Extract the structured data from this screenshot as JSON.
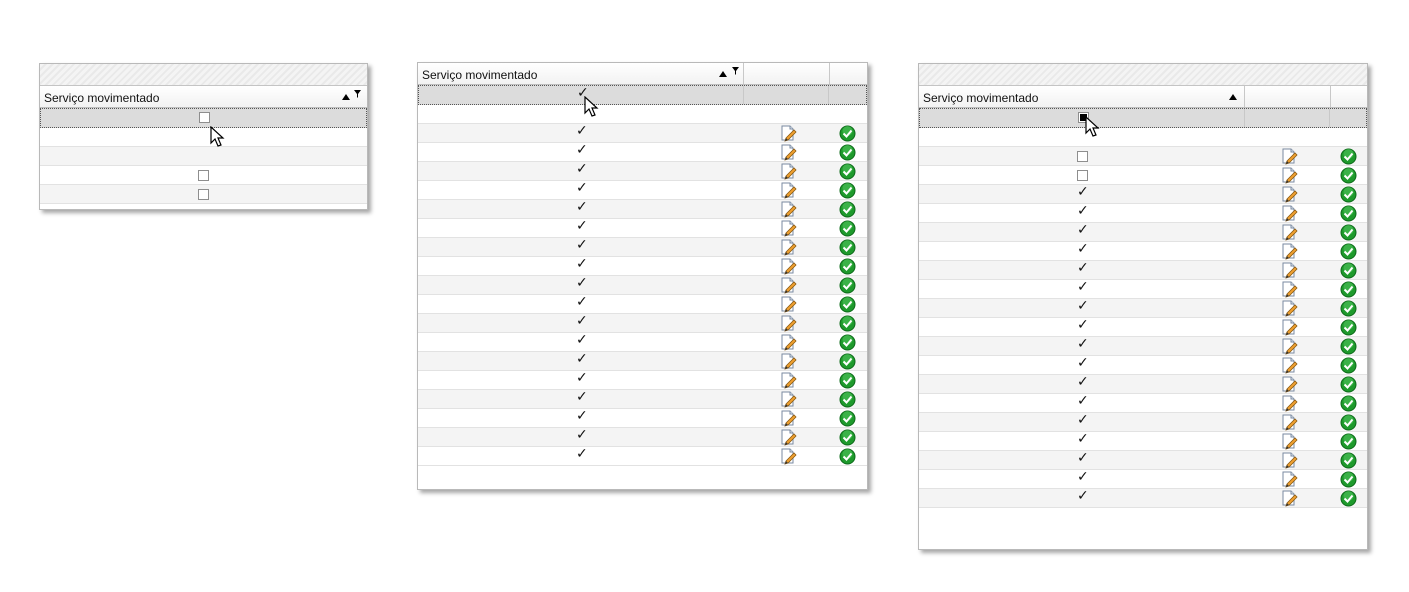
{
  "column_header": "Serviço movimentado",
  "icons": {
    "sort": "sort-ascending-icon",
    "filter": "filter-icon",
    "edit": "edit-document-icon",
    "approve": "green-check-icon",
    "cursor": "mouse-pointer-icon"
  },
  "colors": {
    "approve_green": "#1e9a2c",
    "filter_row_bg": "#dcdcdc",
    "alt_row_bg": "#f4f4f4"
  },
  "panel1": {
    "filter_state": "unchecked",
    "rows": [
      "empty",
      "empty",
      "unchecked",
      "unchecked"
    ]
  },
  "panel2": {
    "filter_state": "checked",
    "rows": [
      "empty",
      "checked",
      "checked",
      "checked",
      "checked",
      "checked",
      "checked",
      "checked",
      "checked",
      "checked",
      "checked",
      "checked",
      "checked",
      "checked",
      "checked",
      "checked",
      "checked",
      "checked",
      "checked"
    ]
  },
  "panel3": {
    "filter_state": "indeterminate",
    "rows": [
      "empty",
      "unchecked",
      "unchecked",
      "checked",
      "checked",
      "checked",
      "checked",
      "checked",
      "checked",
      "checked",
      "checked",
      "checked",
      "checked",
      "checked",
      "checked",
      "checked",
      "checked",
      "checked",
      "checked",
      "checked"
    ]
  }
}
